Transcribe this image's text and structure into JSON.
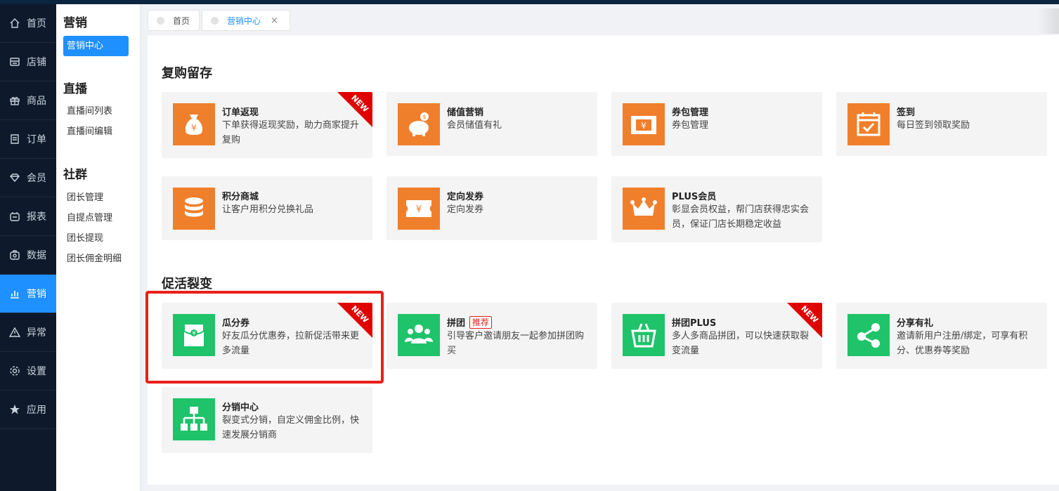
{
  "nav": {
    "items": [
      {
        "label": "首页",
        "icon": "home-icon"
      },
      {
        "label": "店铺",
        "icon": "store-icon"
      },
      {
        "label": "商品",
        "icon": "gift-icon"
      },
      {
        "label": "订单",
        "icon": "order-icon"
      },
      {
        "label": "会员",
        "icon": "diamond-icon"
      },
      {
        "label": "报表",
        "icon": "report-icon"
      },
      {
        "label": "数据",
        "icon": "data-icon"
      },
      {
        "label": "营销",
        "icon": "bar-chart-icon",
        "active": true
      },
      {
        "label": "异常",
        "icon": "warning-icon"
      },
      {
        "label": "设置",
        "icon": "gear-icon"
      },
      {
        "label": "应用",
        "icon": "star-icon"
      }
    ]
  },
  "submenu": {
    "groups": [
      {
        "title": "营销",
        "items": [
          "营销中心"
        ]
      },
      {
        "title": "直播",
        "items": [
          "直播间列表",
          "直播间编辑"
        ]
      },
      {
        "title": "社群",
        "items": [
          "团长管理",
          "自提点管理",
          "团长提现",
          "团长佣金明细"
        ]
      }
    ]
  },
  "tabs": [
    {
      "label": "首页"
    },
    {
      "label": "营销中心",
      "close": "×"
    }
  ],
  "sections": [
    {
      "title": "复购留存",
      "cards": [
        {
          "title": "订单返现",
          "desc": "下单获得返现奖励，助力商家提升复购",
          "icon": "money-bag-icon",
          "badge": "NEW"
        },
        {
          "title": "储值营销",
          "desc": "会员储值有礼",
          "icon": "piggy-bank-icon"
        },
        {
          "title": "券包管理",
          "desc": "券包管理",
          "icon": "coupon-pack-icon"
        },
        {
          "title": "签到",
          "desc": "每日签到领取奖励",
          "icon": "calendar-check-icon"
        },
        {
          "title": "积分商城",
          "desc": "让客户用积分兑换礼品",
          "icon": "coins-icon"
        },
        {
          "title": "定向发券",
          "desc": "定向发券",
          "icon": "ticket-icon"
        },
        {
          "title": "PLUS会员",
          "desc": "彰显会员权益，帮门店获得忠实会员，保证门店长期稳定收益",
          "icon": "crown-icon"
        }
      ]
    },
    {
      "title": "促活裂变",
      "cards": [
        {
          "title": "瓜分券",
          "desc": "好友瓜分优惠券，拉新促活带来更多流量",
          "icon": "red-envelope-icon",
          "badge": "NEW"
        },
        {
          "title": "拼团",
          "tag": "推荐",
          "desc": "引导客户邀请朋友一起参加拼团购买",
          "icon": "group-icon"
        },
        {
          "title": "拼团PLUS",
          "desc": "多人多商品拼团，可以快速获取裂变流量",
          "icon": "basket-icon",
          "badge": "NEW"
        },
        {
          "title": "分享有礼",
          "desc": "邀请新用户注册/绑定，可享有积分、优惠券等奖励",
          "icon": "share-icon"
        },
        {
          "title": "分销中心",
          "desc": "裂变式分销，自定义佣金比例，快速发展分销商",
          "icon": "org-chart-icon"
        }
      ]
    }
  ],
  "colors": {
    "accent": "#1e90ff",
    "orange": "#f07f2c",
    "green": "#1fc36a",
    "highlight": "#e8201a",
    "badge": "#e00000"
  }
}
